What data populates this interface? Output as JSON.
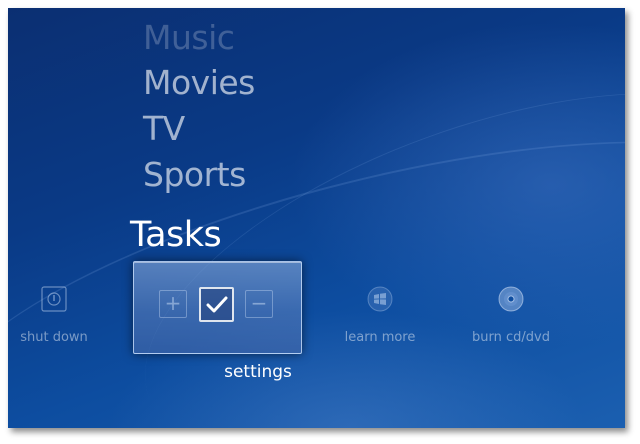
{
  "menu": {
    "items": [
      {
        "label": "Music"
      },
      {
        "label": "Movies"
      },
      {
        "label": "TV"
      },
      {
        "label": "Sports"
      }
    ],
    "section_title": "Tasks"
  },
  "tasks": {
    "items": [
      {
        "label": "shut down",
        "icon": "power-icon"
      },
      {
        "label": "settings",
        "icon": "checkmark-icon",
        "focused": true
      },
      {
        "label": "learn more",
        "icon": "windows-logo-icon"
      },
      {
        "label": "burn cd/dvd",
        "icon": "disc-icon"
      }
    ]
  },
  "colors": {
    "background": "#0a3a86",
    "text": "#ffffff"
  }
}
